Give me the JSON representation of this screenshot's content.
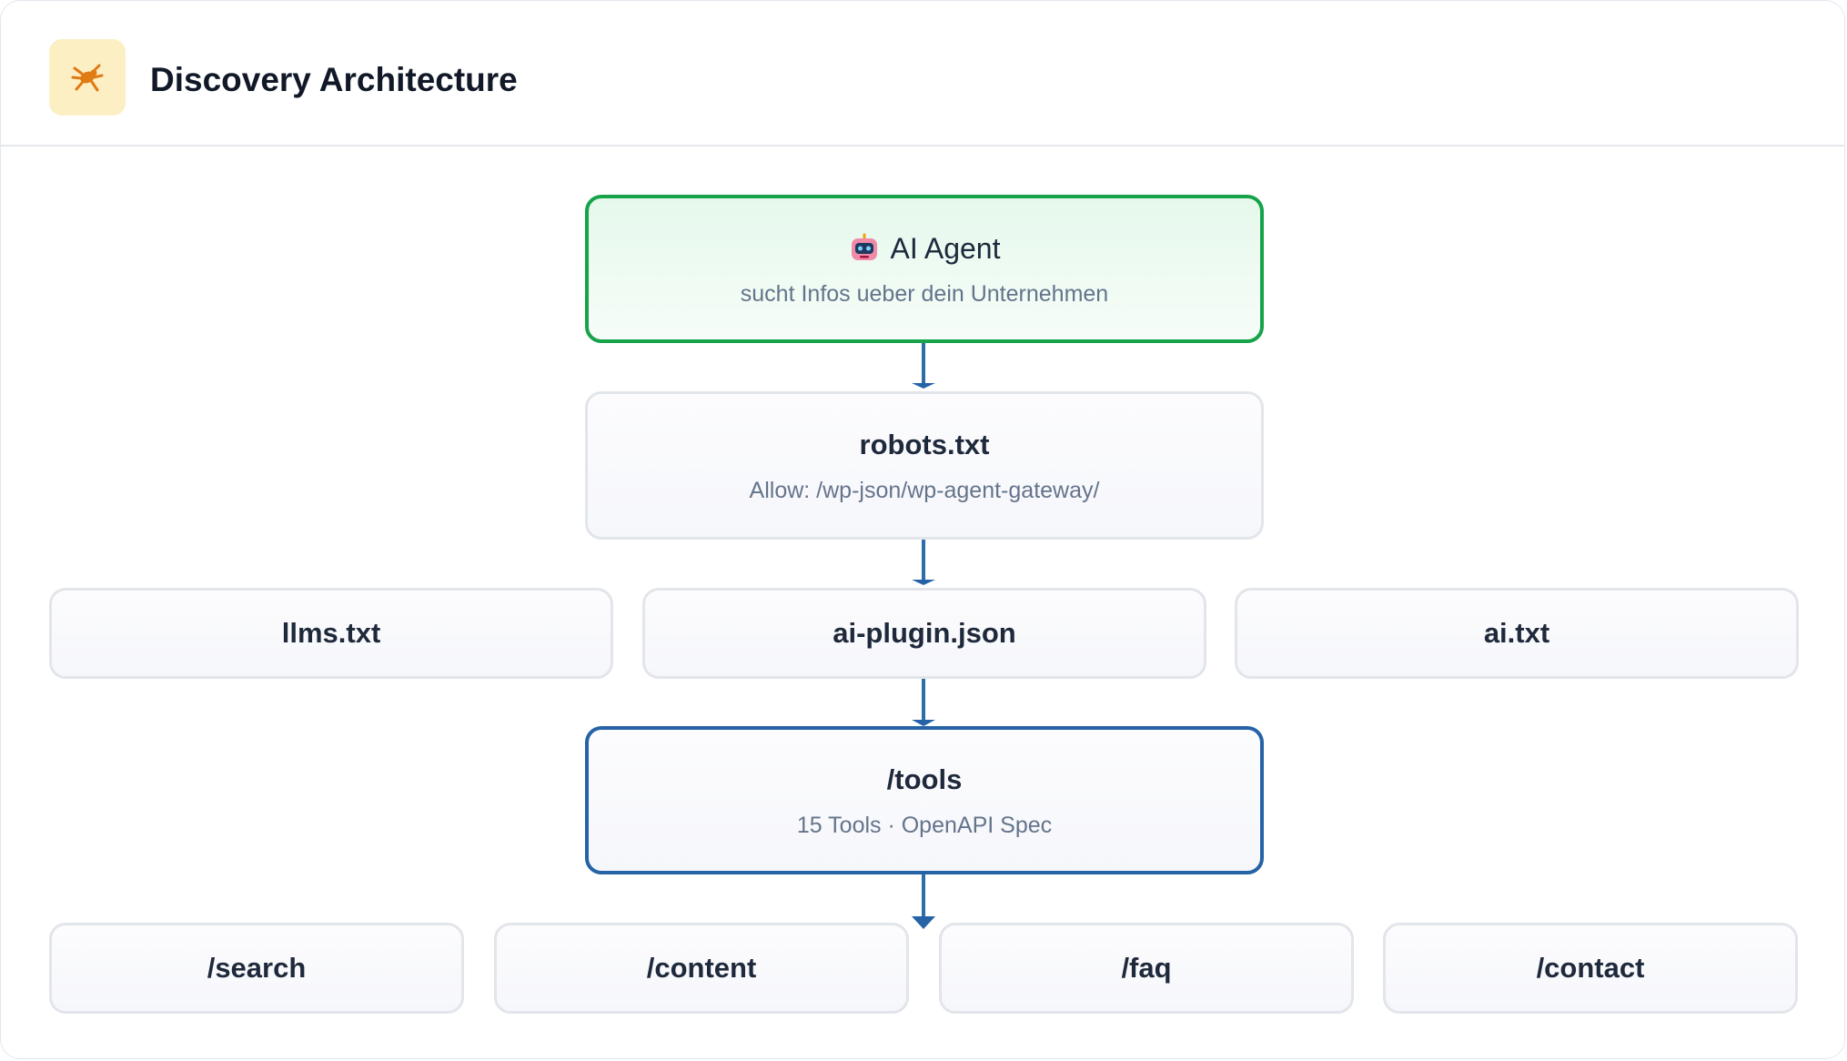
{
  "header": {
    "title": "Discovery Architecture",
    "icon": "spider-icon",
    "icon_bg": "#fdefc4",
    "icon_color": "#e07a12"
  },
  "diagram": {
    "agent": {
      "title": "AI Agent",
      "subtitle": "sucht Infos ueber dein Unternehmen",
      "icon": "robot-icon"
    },
    "robots": {
      "title": "robots.txt",
      "subtitle": "Allow: /wp-json/wp-agent-gateway/"
    },
    "files": [
      {
        "label": "llms.txt"
      },
      {
        "label": "ai-plugin.json"
      },
      {
        "label": "ai.txt"
      }
    ],
    "tools": {
      "title": "/tools",
      "subtitle": "15 Tools · OpenAPI Spec"
    },
    "endpoints": [
      {
        "label": "/search"
      },
      {
        "label": "/content"
      },
      {
        "label": "/faq"
      },
      {
        "label": "/contact"
      }
    ]
  },
  "colors": {
    "agent_border": "#16a34a",
    "tools_border": "#2563a6",
    "connector": "#2563a6",
    "node_border": "#e2e5ea"
  }
}
